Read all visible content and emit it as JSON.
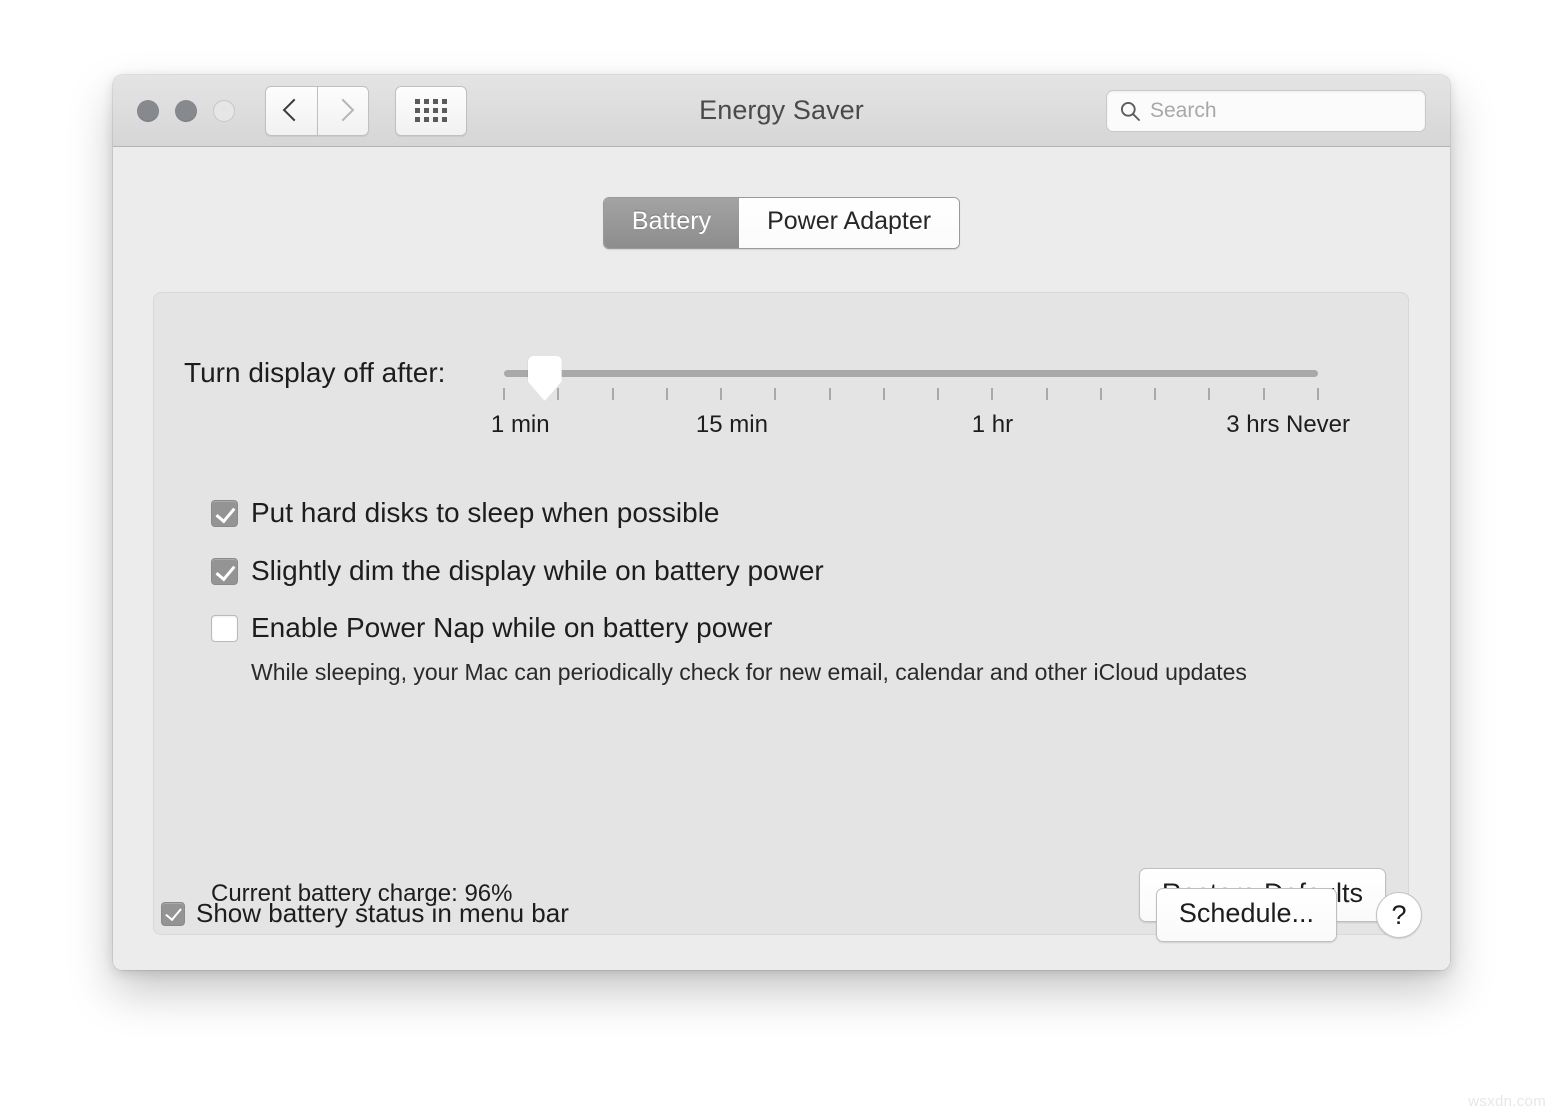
{
  "window": {
    "title": "Energy Saver",
    "traffic_lights": [
      "close",
      "minimize",
      "zoom"
    ],
    "nav": {
      "back_icon": "chevron-left-icon",
      "forward_icon": "chevron-right-icon",
      "grid_icon": "grid-dots-icon"
    },
    "search": {
      "placeholder": "Search",
      "icon": "search-icon",
      "value": ""
    }
  },
  "tabs": [
    {
      "label": "Battery",
      "selected": true
    },
    {
      "label": "Power Adapter",
      "selected": false
    }
  ],
  "slider": {
    "label": "Turn display off after:",
    "value_percent": 5,
    "tick_count": 16,
    "tick_labels": [
      {
        "text": "1 min",
        "position_percent": 2
      },
      {
        "text": "15 min",
        "position_percent": 28
      },
      {
        "text": "1 hr",
        "position_percent": 60
      },
      {
        "text": "3 hrs",
        "position_percent": 92
      },
      {
        "text": "Never",
        "position_percent": 100
      }
    ]
  },
  "checkboxes": [
    {
      "label": "Put hard disks to sleep when possible",
      "checked": true,
      "note": ""
    },
    {
      "label": "Slightly dim the display while on battery power",
      "checked": true,
      "note": ""
    },
    {
      "label": "Enable Power Nap while on battery power",
      "checked": false,
      "note": "While sleeping, your Mac can periodically check for new email, calendar and other iCloud updates"
    }
  ],
  "panel": {
    "battery_charge": "Current battery charge: 96%",
    "restore_defaults_label": "Restore Defaults"
  },
  "footer": {
    "menubar_checkbox": {
      "label": "Show battery status in menu bar",
      "checked": true
    },
    "schedule_label": "Schedule...",
    "help_label": "?"
  },
  "watermark": "wsxdn.com",
  "colors": {
    "window_bg": "#ececec",
    "panel_bg": "#e4e4e4",
    "titlebar_top": "#e4e4e4",
    "titlebar_bottom": "#d6d6d6",
    "tab_active_bg": "#8d8d8d",
    "checkbox_on": "#949494",
    "track": "#a9a9a9",
    "text": "#1d1d1d"
  }
}
